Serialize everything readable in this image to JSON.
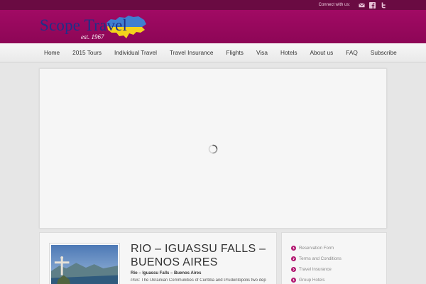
{
  "topbar": {
    "connect_label": "Connect with us:",
    "icons": [
      "email-icon",
      "facebook-icon",
      "twitter-icon"
    ]
  },
  "logo": {
    "brand": "Scope Travel",
    "est": "est. 1967"
  },
  "nav": {
    "items": [
      "Home",
      "2015 Tours",
      "Individual Travel",
      "Travel Insurance",
      "Flights",
      "Visa",
      "Hotels",
      "About us",
      "FAQ",
      "Subscribe"
    ]
  },
  "post": {
    "title": "RIO – IGUASSU FALLS – BUENOS AIRES",
    "subtitle": "Rio – Iguassu Falls – Buenos Aires",
    "desc_prefix": "Plus:",
    "desc": " The Ukrainian Communities of Curitiba and Prudentopolis two dep"
  },
  "sidebar": {
    "links": [
      "Reservation Form",
      "Terms and Conditions",
      "Travel Insurance",
      "Group Hotels"
    ]
  },
  "colors": {
    "topbar": "#6a0b42",
    "header": "#a10a64",
    "brand_blue": "#1f2f88",
    "accent": "#b1156f"
  }
}
